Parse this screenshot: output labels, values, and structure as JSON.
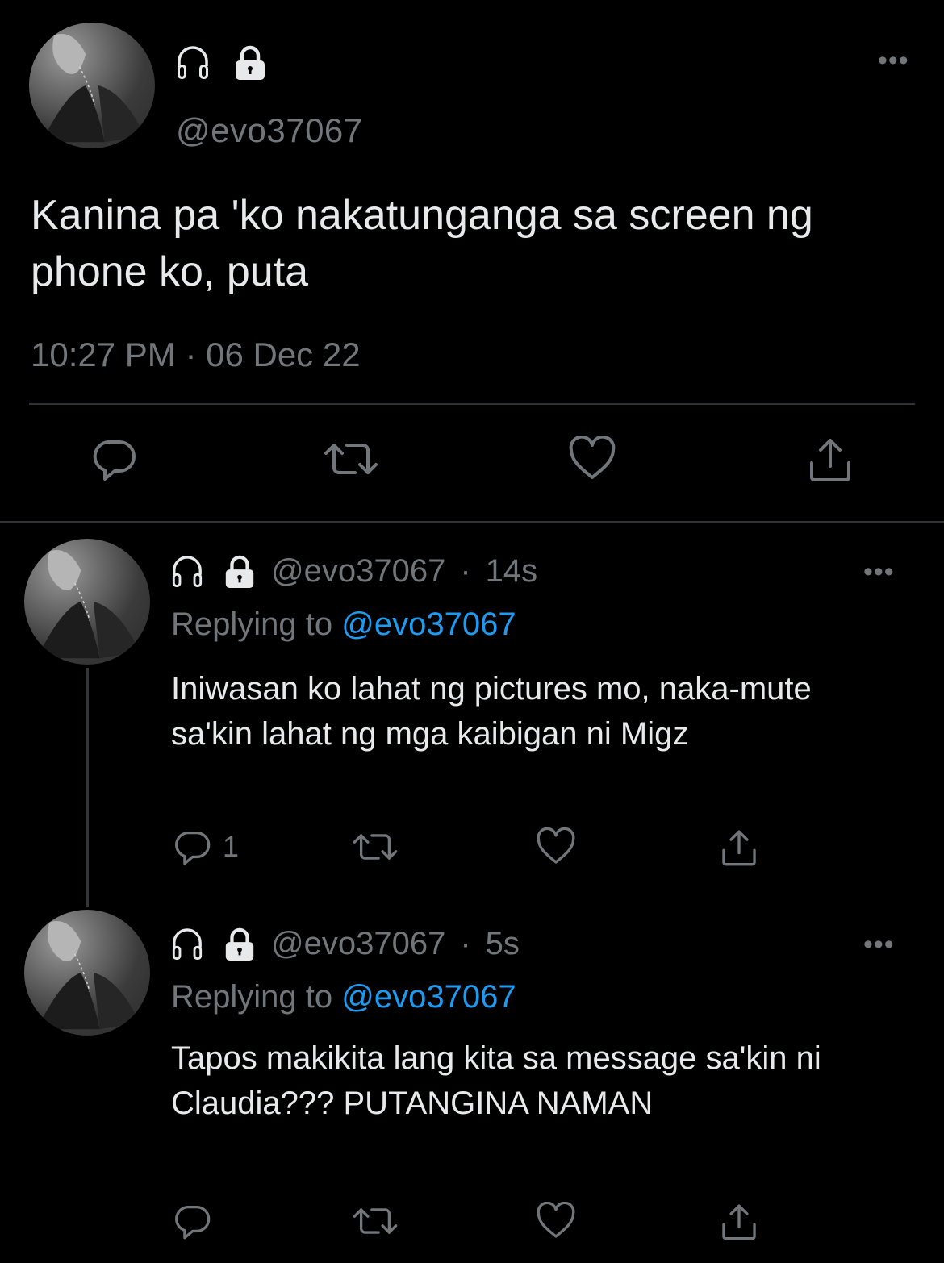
{
  "main_tweet": {
    "handle": "@evo37067",
    "icons": [
      "headphones-icon",
      "lock-icon"
    ],
    "more": "•••",
    "text": "Kanina pa 'ko nakatunganga sa screen ng phone ko, puta",
    "timestamp": "10:27 PM · 06 Dec 22",
    "actions": [
      "reply-icon",
      "retweet-icon",
      "like-icon",
      "share-icon"
    ]
  },
  "replies": [
    {
      "handle": "@evo37067",
      "sep": "·",
      "time": "14s",
      "replying_label": "Replying to",
      "replying_to": "@evo37067",
      "more": "•••",
      "text": "Iniwasan ko lahat ng pictures mo, naka-mute sa'kin lahat ng mga kaibigan ni Migz",
      "reply_count": "1"
    },
    {
      "handle": "@evo37067",
      "sep": "·",
      "time": "5s",
      "replying_label": "Replying to",
      "replying_to": "@evo37067",
      "more": "•••",
      "text": "Tapos makikita lang kita sa message sa'kin ni Claudia??? PUTANGINA NAMAN",
      "reply_count": ""
    }
  ],
  "colors": {
    "background": "#000000",
    "text": "#e7e9ea",
    "muted": "#71767b",
    "accent": "#1d9bf0",
    "divider": "#2f3336"
  }
}
